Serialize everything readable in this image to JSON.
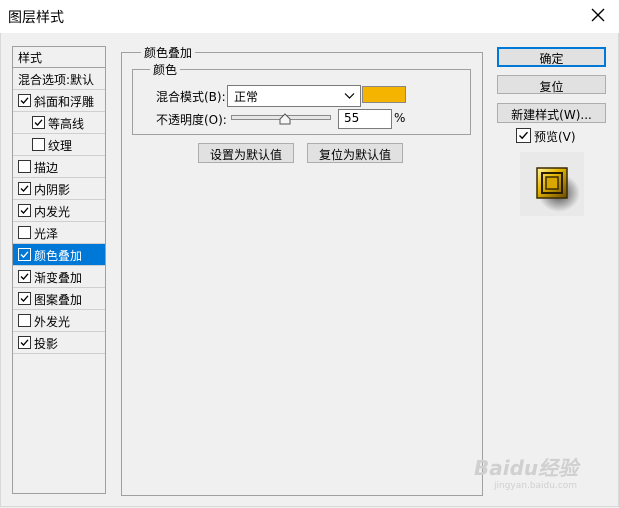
{
  "window": {
    "title": "图层样式"
  },
  "style_list": {
    "header": "样式",
    "items": [
      {
        "label": "混合选项:默认",
        "has_checkbox": false,
        "checked": false,
        "indent": false,
        "selected": false
      },
      {
        "label": "斜面和浮雕",
        "has_checkbox": true,
        "checked": true,
        "indent": false,
        "selected": false
      },
      {
        "label": "等高线",
        "has_checkbox": true,
        "checked": true,
        "indent": true,
        "selected": false
      },
      {
        "label": "纹理",
        "has_checkbox": true,
        "checked": false,
        "indent": true,
        "selected": false
      },
      {
        "label": "描边",
        "has_checkbox": true,
        "checked": false,
        "indent": false,
        "selected": false
      },
      {
        "label": "内阴影",
        "has_checkbox": true,
        "checked": true,
        "indent": false,
        "selected": false
      },
      {
        "label": "内发光",
        "has_checkbox": true,
        "checked": true,
        "indent": false,
        "selected": false
      },
      {
        "label": "光泽",
        "has_checkbox": true,
        "checked": false,
        "indent": false,
        "selected": false
      },
      {
        "label": "颜色叠加",
        "has_checkbox": true,
        "checked": true,
        "indent": false,
        "selected": true
      },
      {
        "label": "渐变叠加",
        "has_checkbox": true,
        "checked": true,
        "indent": false,
        "selected": false
      },
      {
        "label": "图案叠加",
        "has_checkbox": true,
        "checked": true,
        "indent": false,
        "selected": false
      },
      {
        "label": "外发光",
        "has_checkbox": true,
        "checked": false,
        "indent": false,
        "selected": false
      },
      {
        "label": "投影",
        "has_checkbox": true,
        "checked": true,
        "indent": false,
        "selected": false
      }
    ]
  },
  "main": {
    "section_title": "颜色叠加",
    "group_title": "颜色",
    "blend_mode_label": "混合模式(B):",
    "blend_mode_value": "正常",
    "overlay_color": "#f5b400",
    "opacity_label": "不透明度(O):",
    "opacity_value": "55",
    "opacity_unit": "%",
    "opacity_fraction": 0.55,
    "set_default_button": "设置为默认值",
    "reset_default_button": "复位为默认值"
  },
  "right": {
    "ok_button": "确定",
    "reset_button": "复位",
    "new_style_button": "新建样式(W)...",
    "preview_label": "预览(V)",
    "preview_checked": true
  },
  "watermark": {
    "text": "Baidu经验",
    "subtext": "jingyan.baidu.com"
  },
  "colors": {
    "selection": "#0078d7",
    "accent_border": "#0078d7"
  }
}
